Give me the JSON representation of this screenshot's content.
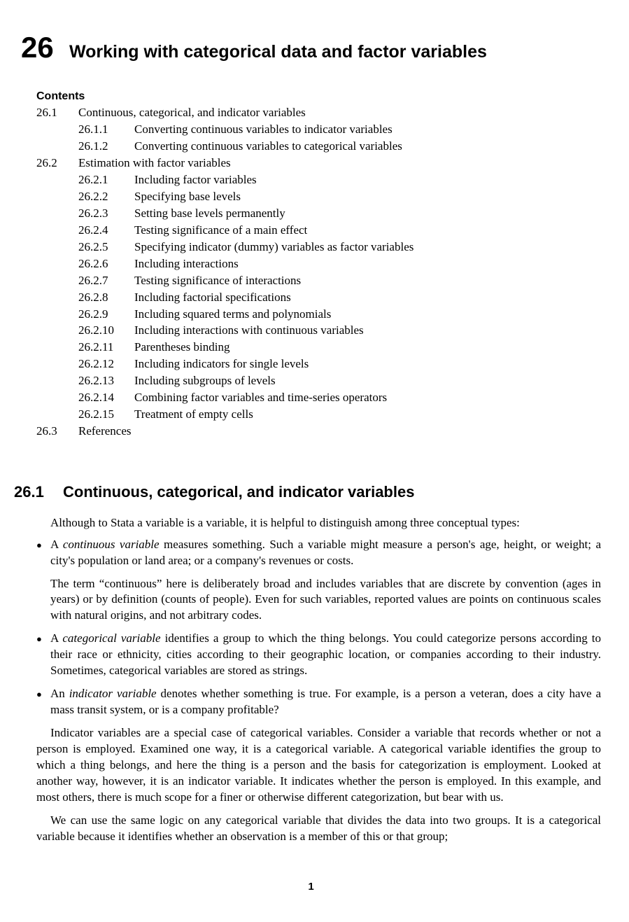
{
  "chapter": {
    "number": "26",
    "title": "Working with categorical data and factor variables"
  },
  "contents_heading": "Contents",
  "toc": [
    {
      "level": 1,
      "num": "26.1",
      "text": "Continuous, categorical, and indicator variables"
    },
    {
      "level": 2,
      "num": "26.1.1",
      "text": "Converting continuous variables to indicator variables"
    },
    {
      "level": 2,
      "num": "26.1.2",
      "text": "Converting continuous variables to categorical variables"
    },
    {
      "level": 1,
      "num": "26.2",
      "text": "Estimation with factor variables"
    },
    {
      "level": 2,
      "num": "26.2.1",
      "text": "Including factor variables"
    },
    {
      "level": 2,
      "num": "26.2.2",
      "text": "Specifying base levels"
    },
    {
      "level": 2,
      "num": "26.2.3",
      "text": "Setting base levels permanently"
    },
    {
      "level": 2,
      "num": "26.2.4",
      "text": "Testing significance of a main effect"
    },
    {
      "level": 2,
      "num": "26.2.5",
      "text": "Specifying indicator (dummy) variables as factor variables"
    },
    {
      "level": 2,
      "num": "26.2.6",
      "text": "Including interactions"
    },
    {
      "level": 2,
      "num": "26.2.7",
      "text": "Testing significance of interactions"
    },
    {
      "level": 2,
      "num": "26.2.8",
      "text": "Including factorial specifications"
    },
    {
      "level": 2,
      "num": "26.2.9",
      "text": "Including squared terms and polynomials"
    },
    {
      "level": 2,
      "num": "26.2.10",
      "text": "Including interactions with continuous variables"
    },
    {
      "level": 2,
      "num": "26.2.11",
      "text": "Parentheses binding"
    },
    {
      "level": 2,
      "num": "26.2.12",
      "text": "Including indicators for single levels"
    },
    {
      "level": 2,
      "num": "26.2.13",
      "text": "Including subgroups of levels"
    },
    {
      "level": 2,
      "num": "26.2.14",
      "text": "Combining factor variables and time-series operators"
    },
    {
      "level": 2,
      "num": "26.2.15",
      "text": "Treatment of empty cells"
    },
    {
      "level": 1,
      "num": "26.3",
      "text": "References"
    }
  ],
  "section": {
    "number": "26.1",
    "title": "Continuous, categorical, and indicator variables"
  },
  "intro": "Although to Stata a variable is a variable, it is helpful to distinguish among three conceptual types:",
  "bullets": [
    {
      "lead_term": "continuous variable",
      "lead_prefix": "A ",
      "lead_suffix": " measures something. Such a variable might measure a person's age, height, or weight; a city's population or land area; or a company's revenues or costs.",
      "extra": "The term “continuous” here is deliberately broad and includes variables that are discrete by convention (ages in years) or by definition (counts of people). Even for such variables, reported values are points on continuous scales with natural origins, and not arbitrary codes."
    },
    {
      "lead_term": "categorical variable",
      "lead_prefix": "A ",
      "lead_suffix": " identifies a group to which the thing belongs. You could categorize persons according to their race or ethnicity, cities according to their geographic location, or companies according to their industry. Sometimes, categorical variables are stored as strings.",
      "extra": ""
    },
    {
      "lead_term": "indicator variable",
      "lead_prefix": "An ",
      "lead_suffix": " denotes whether something is true. For example, is a person a veteran, does a city have a mass transit system, or is a company profitable?",
      "extra": ""
    }
  ],
  "para1": "Indicator variables are a special case of categorical variables. Consider a variable that records whether or not a person is employed. Examined one way, it is a categorical variable. A categorical variable identifies the group to which a thing belongs, and here the thing is a person and the basis for categorization is employment. Looked at another way, however, it is an indicator variable. It indicates whether the person is employed. In this example, and most others, there is much scope for a finer or otherwise different categorization, but bear with us.",
  "para2": "We can use the same logic on any categorical variable that divides the data into two groups. It is a categorical variable because it identifies whether an observation is a member of this or that group;",
  "page_number": "1"
}
